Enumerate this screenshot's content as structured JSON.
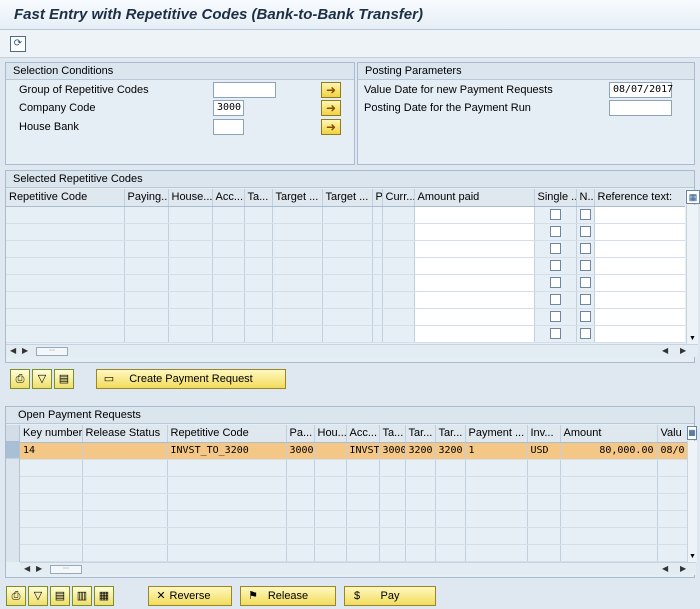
{
  "title": "Fast Entry with Repetitive Codes (Bank-to-Bank Transfer)",
  "toolbar": {
    "icon": "refresh-icon"
  },
  "selection_conditions": {
    "title": "Selection Conditions",
    "fields": [
      {
        "label": "Group of Repetitive Codes",
        "value": ""
      },
      {
        "label": "Company Code",
        "value": "3000"
      },
      {
        "label": "House Bank",
        "value": ""
      }
    ]
  },
  "posting_parameters": {
    "title": "Posting Parameters",
    "fields": [
      {
        "label": "Value Date for new Payment Requests",
        "value": "08/07/2017"
      },
      {
        "label": "Posting Date for the Payment Run",
        "value": ""
      }
    ]
  },
  "selected_codes": {
    "title": "Selected Repetitive Codes",
    "columns": [
      "Repetitive Code",
      "Paying...",
      "House...",
      "Acc...",
      "Ta...",
      "Target ...",
      "Target ...",
      "P",
      "Curr...",
      "Amount paid",
      "Single ...",
      "N...",
      "Reference text:"
    ],
    "create_button": "Create Payment Request"
  },
  "open_requests": {
    "title": "Open Payment Requests",
    "columns": [
      "Key number",
      "Release Status",
      "Repetitive Code",
      "Pa...",
      "Hou...",
      "Acc...",
      "Ta...",
      "Tar...",
      "Tar...",
      "Payment ...",
      "Inv...",
      "Amount",
      "Valu"
    ],
    "rows": [
      {
        "key": "14",
        "status": "",
        "code": "INVST_TO_3200",
        "pa": "3000",
        "hou": "",
        "acc": "INVST",
        "ta": "3000",
        "tar1": "3200",
        "tar2": "3200",
        "payment": "1",
        "inv": "USD",
        "amount": "80,000.00",
        "valu": "08/0"
      }
    ],
    "buttons": {
      "reverse": "Reverse",
      "release": "Release",
      "pay": "Pay"
    }
  }
}
